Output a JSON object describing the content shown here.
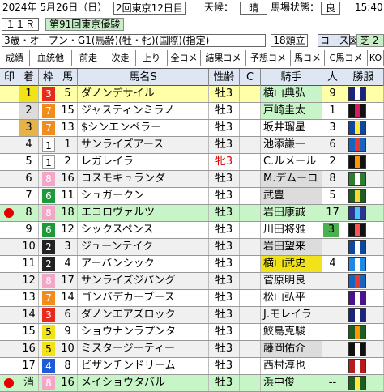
{
  "header": {
    "date": "2024年 5月26日（日）",
    "meeting": "2回東京12日目",
    "weather_label": "天候：",
    "weather": "晴",
    "track_label": "馬場状態：",
    "track": "良",
    "time": "15:40",
    "race_no": "１１Ｒ",
    "race_name": "第91回東京優駿",
    "conditions": "3歳・オープン・G1(馬齢)(牡・牝)(国際)(指定)",
    "field": "18頭立",
    "course_label": "コース図",
    "surface": "芝 2"
  },
  "tabs": [
    "成績",
    "血統他",
    "前走",
    "次走",
    "上り",
    "全コメ",
    "結果コメ",
    "予想コメ",
    "馬コメ",
    "C馬コメ",
    "KO"
  ],
  "columns": [
    "印",
    "着",
    "枠",
    "馬",
    "馬名S",
    "性齢",
    "C",
    "騎手",
    "人",
    "勝服"
  ],
  "colors": {
    "gate": {
      "1": "#ffffff",
      "2": "#222222",
      "3": "#e8291c",
      "4": "#1f5bd6",
      "5": "#f1e21a",
      "6": "#1f9a3a",
      "7": "#f28c1d",
      "8": "#f4a6c8"
    },
    "gate_text": {
      "1": "#000000",
      "2": "#ffffff",
      "3": "#ffffff",
      "4": "#ffffff",
      "5": "#000000",
      "6": "#ffffff",
      "7": "#ffffff",
      "8": "#ffffff"
    }
  },
  "rows": [
    {
      "mark": "",
      "finish": "1",
      "gate": "3",
      "num": "5",
      "name": "ダノンデサイル",
      "sexage": "牡3",
      "jockey": "横山典弘",
      "pop": "9",
      "style": "hl",
      "finishbg": "#f1e21a",
      "jockeybg": "#c8f5c8",
      "silk": [
        "#1a237e",
        "#ffffff"
      ]
    },
    {
      "mark": "",
      "finish": "2",
      "gate": "7",
      "num": "15",
      "name": "ジャスティンミラノ",
      "sexage": "牡3",
      "jockey": "戸崎圭太",
      "pop": "1",
      "style": "",
      "finishbg": "#dcdcdc",
      "jockeybg": "#c8f5c8",
      "silk": [
        "#111111",
        "#d81b60"
      ]
    },
    {
      "mark": "",
      "finish": "3",
      "gate": "7",
      "num": "13",
      "name": "$シンエンペラー",
      "sexage": "牡3",
      "jockey": "坂井瑠星",
      "pop": "3",
      "style": "",
      "finishbg": "#e6b34a",
      "jockeybg": "",
      "silk": [
        "#0d47a1",
        "#ffeb3b"
      ]
    },
    {
      "mark": "",
      "finish": "4",
      "gate": "1",
      "num": "1",
      "name": "サンライズアース",
      "sexage": "牡3",
      "jockey": "池添謙一",
      "pop": "6",
      "style": "alt",
      "finishbg": "",
      "jockeybg": "",
      "silk": [
        "#1565c0",
        "#e53935"
      ]
    },
    {
      "mark": "",
      "finish": "5",
      "gate": "1",
      "num": "2",
      "name": "レガレイラ",
      "sexage": "牝3",
      "jockey": "C.ルメール",
      "pop": "2",
      "style": "",
      "finishbg": "",
      "jockeybg": "",
      "silk": [
        "#111111",
        "#ff9800"
      ],
      "female": true
    },
    {
      "mark": "",
      "finish": "6",
      "gate": "8",
      "num": "16",
      "name": "コスモキュランダ",
      "sexage": "牡3",
      "jockey": "M.デムーロ",
      "pop": "8",
      "style": "alt",
      "finishbg": "",
      "jockeybg": "#dcdcdc",
      "silk": [
        "#2e7d32",
        "#ffffff"
      ]
    },
    {
      "mark": "",
      "finish": "7",
      "gate": "6",
      "num": "11",
      "name": "シュガークン",
      "sexage": "牡3",
      "jockey": "武豊",
      "pop": "5",
      "style": "",
      "finishbg": "",
      "jockeybg": "#dcdcdc",
      "silk": [
        "#1b5e20",
        "#fdd835"
      ]
    },
    {
      "mark": "red",
      "finish": "8",
      "gate": "8",
      "num": "18",
      "name": "エコロヴァルツ",
      "sexage": "牡3",
      "jockey": "岩田康誠",
      "pop": "17",
      "style": "sel",
      "finishbg": "",
      "jockeybg": "",
      "silk": [
        "#283593",
        "#4fc3f7"
      ]
    },
    {
      "mark": "",
      "finish": "9",
      "gate": "6",
      "num": "12",
      "name": "シックスペンス",
      "sexage": "牡3",
      "jockey": "川田将雅",
      "pop": "3",
      "style": "",
      "finishbg": "",
      "jockeybg": "",
      "popbg": "#4caf50",
      "silk": [
        "#111111",
        "#ff5252"
      ]
    },
    {
      "mark": "",
      "finish": "10",
      "gate": "2",
      "num": "3",
      "name": "ジューンテイク",
      "sexage": "牡3",
      "jockey": "岩田望来",
      "pop": "",
      "style": "alt",
      "finishbg": "",
      "jockeybg": "#dcdcdc",
      "silk": [
        "#0d47a1",
        "#ffffff"
      ]
    },
    {
      "mark": "",
      "finish": "11",
      "gate": "2",
      "num": "4",
      "name": "アーバンシック",
      "sexage": "牡3",
      "jockey": "横山武史",
      "pop": "4",
      "style": "",
      "finishbg": "",
      "jockeybg": "#f1e21a",
      "silk": [
        "#1e88e5",
        "#ffffff"
      ]
    },
    {
      "mark": "",
      "finish": "12",
      "gate": "8",
      "num": "17",
      "name": "サンライズジパング",
      "sexage": "牡3",
      "jockey": "菅原明良",
      "pop": "",
      "style": "alt",
      "finishbg": "",
      "jockeybg": "",
      "silk": [
        "#1565c0",
        "#e53935"
      ]
    },
    {
      "mark": "",
      "finish": "13",
      "gate": "7",
      "num": "14",
      "name": "ゴンバデカーブース",
      "sexage": "牡3",
      "jockey": "松山弘平",
      "pop": "",
      "style": "",
      "finishbg": "",
      "jockeybg": "",
      "silk": [
        "#4a148c",
        "#ffffff"
      ]
    },
    {
      "mark": "",
      "finish": "14",
      "gate": "3",
      "num": "6",
      "name": "ダノンエアズロック",
      "sexage": "牡3",
      "jockey": "J.モレイラ",
      "pop": "",
      "style": "alt",
      "finishbg": "",
      "jockeybg": "",
      "silk": [
        "#1a237e",
        "#ffffff"
      ]
    },
    {
      "mark": "",
      "finish": "15",
      "gate": "5",
      "num": "9",
      "name": "ショウナンラプンタ",
      "sexage": "牡3",
      "jockey": "鮫島克駿",
      "pop": "",
      "style": "",
      "finishbg": "",
      "jockeybg": "",
      "silk": [
        "#1b5e20",
        "#ff9800"
      ]
    },
    {
      "mark": "",
      "finish": "16",
      "gate": "5",
      "num": "10",
      "name": "ミスタージーティー",
      "sexage": "牡3",
      "jockey": "藤岡佑介",
      "pop": "",
      "style": "alt",
      "finishbg": "",
      "jockeybg": "#dcdcdc",
      "silk": [
        "#111111",
        "#ffffff"
      ]
    },
    {
      "mark": "",
      "finish": "17",
      "gate": "4",
      "num": "8",
      "name": "ビザンチンドリーム",
      "sexage": "牡3",
      "jockey": "西村淳也",
      "pop": "",
      "style": "",
      "finishbg": "",
      "jockeybg": "",
      "silk": [
        "#b71c1c",
        "#ffffff"
      ]
    },
    {
      "mark": "red",
      "finish": "消",
      "gate": "8",
      "num": "16",
      "name": "メイショウタバル",
      "sexage": "牡3",
      "jockey": "浜中俊",
      "pop": "--",
      "style": "sel",
      "finishbg": "",
      "jockeybg": "",
      "silk": [
        "#1b5e20",
        "#ffeb3b"
      ]
    }
  ]
}
